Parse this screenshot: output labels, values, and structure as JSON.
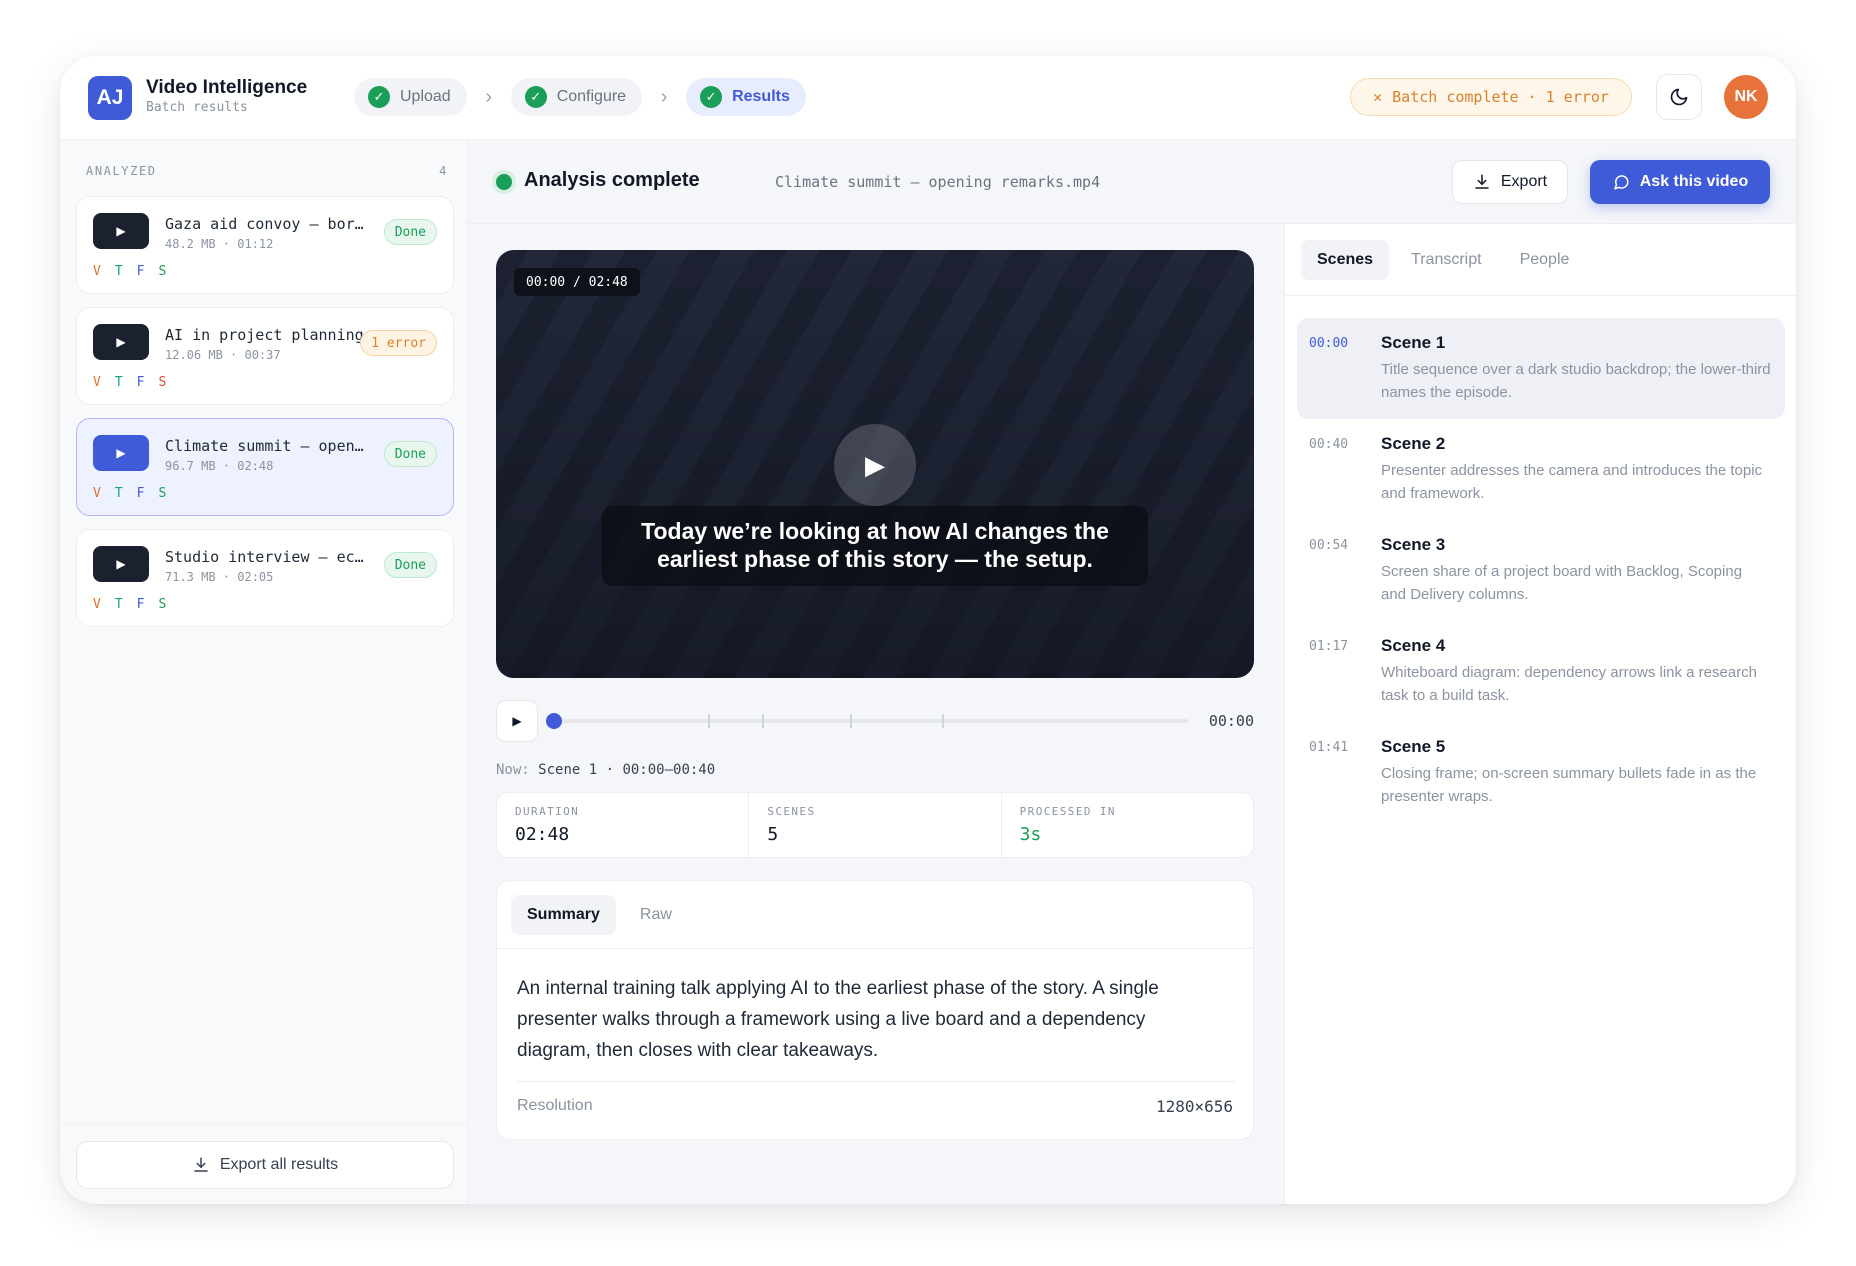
{
  "header": {
    "logo_text": "AJ",
    "title": "Video Intelligence",
    "subtitle": "Batch results",
    "steps": [
      {
        "label": "Upload"
      },
      {
        "label": "Configure"
      },
      {
        "label": "Results"
      }
    ],
    "batch_status": "Batch complete · 1 error",
    "avatar_initials": "NK"
  },
  "sidebar": {
    "section_label": "ANALYZED",
    "count": "4",
    "files": [
      {
        "name": "Gaza aid convoy — border crossing",
        "meta": "48.2 MB · 01:12",
        "status": "Done"
      },
      {
        "name": "AI in project planning",
        "meta": "12.06 MB · 00:37",
        "status": "1 error"
      },
      {
        "name": "Climate summit — opening remarks",
        "meta": "96.7 MB · 02:48",
        "status": "Done"
      },
      {
        "name": "Studio interview — ecology",
        "meta": "71.3 MB · 02:05",
        "status": "Done"
      }
    ],
    "flags": [
      "V",
      "T",
      "F",
      "S"
    ],
    "export_all_label": "Export all results"
  },
  "main": {
    "status": "Analysis complete",
    "file_title": "Climate summit — opening remarks.mp4",
    "export_label": "Export",
    "ask_label": "Ask this video",
    "video": {
      "timecode": "00:00 / 02:48",
      "caption": "Today we’re looking at how AI changes the earliest phase of this story — the setup.",
      "progress_fraction": 0
    },
    "controls": {
      "time": "00:00",
      "now_label": "Now:",
      "now_value": "Scene 1 · 00:00–00:40"
    },
    "stats": [
      {
        "label": "DURATION",
        "value": "02:48"
      },
      {
        "label": "SCENES",
        "value": "5"
      },
      {
        "label": "PROCESSED IN",
        "value": "3s"
      }
    ],
    "summary": {
      "tabs": [
        "Summary",
        "Raw"
      ],
      "text": "An internal training talk applying AI to the earliest phase of the story. A single presenter walks through a framework using a live board and a dependency diagram, then closes with clear takeaways.",
      "resolution_label": "Resolution",
      "resolution_value": "1280×656"
    }
  },
  "scenes_panel": {
    "tabs": [
      "Scenes",
      "Transcript",
      "People"
    ],
    "scenes": [
      {
        "time": "00:00",
        "title": "Scene 1",
        "desc": "Title sequence over a dark studio backdrop; the lower-third names the episode."
      },
      {
        "time": "00:40",
        "title": "Scene 2",
        "desc": "Presenter addresses the camera and introduces the topic and framework."
      },
      {
        "time": "00:54",
        "title": "Scene 3",
        "desc": "Screen share of a project board with Backlog, Scoping and Delivery columns."
      },
      {
        "time": "01:17",
        "title": "Scene 4",
        "desc": "Whiteboard diagram: dependency arrows link a research task to a build task."
      },
      {
        "time": "01:41",
        "title": "Scene 5",
        "desc": "Closing frame; on-screen summary bullets fade in as the presenter wraps."
      }
    ]
  },
  "colors": {
    "accent": "#3f5bd8",
    "success": "#1a9e58",
    "warning": "#d9822b",
    "avatar": "#e8733a"
  },
  "icons": {
    "check": "check-icon",
    "chevron": "chevron-right-icon",
    "moon": "moon-icon",
    "download": "download-icon",
    "chat": "chat-bubble-icon",
    "play": "play-icon",
    "close": "close-icon"
  }
}
